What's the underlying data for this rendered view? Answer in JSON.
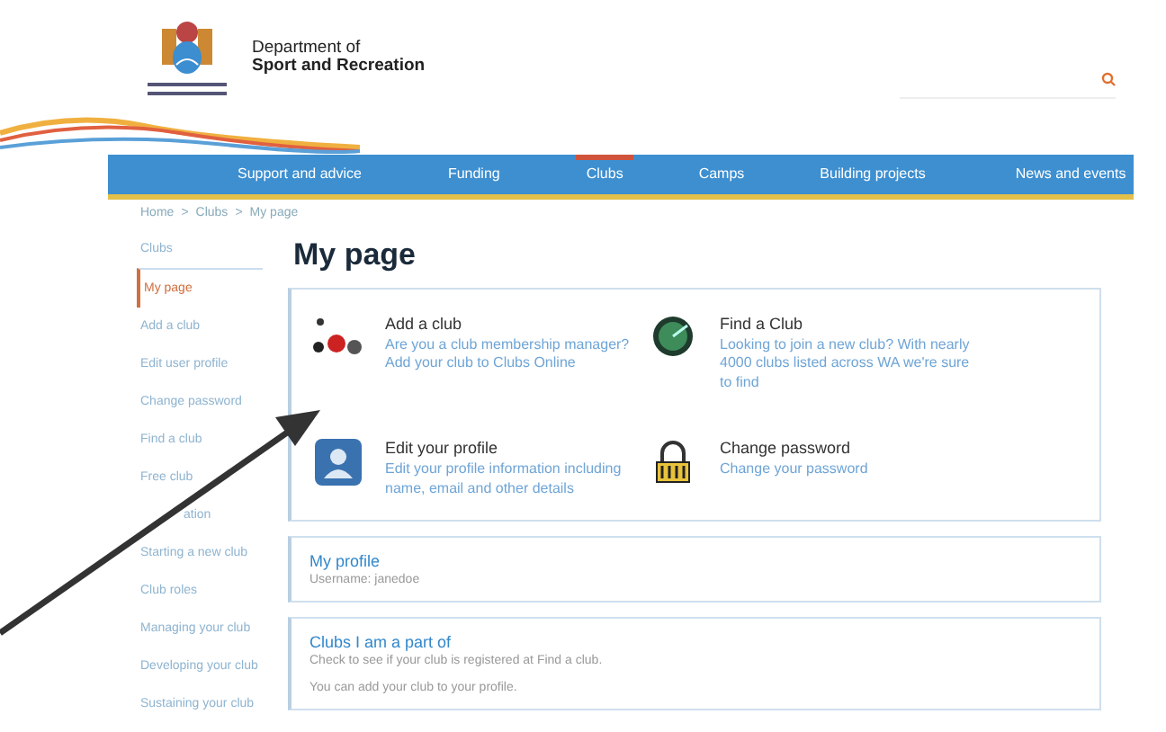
{
  "header": {
    "org_line_1": "Department of",
    "org_line_2": "Sport and Recreation"
  },
  "nav": [
    {
      "label": "Support and advice",
      "selected": false
    },
    {
      "label": "Funding",
      "selected": false
    },
    {
      "label": "Clubs",
      "selected": true
    },
    {
      "label": "Camps",
      "selected": false
    },
    {
      "label": "Building projects",
      "selected": false
    },
    {
      "label": "News and events",
      "selected": false
    }
  ],
  "breadcrumb": {
    "separator": ">",
    "items": [
      "Home",
      "Clubs",
      "My page"
    ]
  },
  "sidebar": {
    "heading": "Clubs",
    "items": [
      {
        "label": "My page",
        "selected": true
      },
      {
        "label": "Add a club",
        "selected": false
      },
      {
        "label": "Edit user profile",
        "selected": false
      },
      {
        "label": "Change password",
        "selected": false
      },
      {
        "label": "Find a club",
        "selected": false
      },
      {
        "label": "Free club",
        "selected": false
      },
      {
        "label": "ation",
        "selected": false
      },
      {
        "label": "Starting a new club",
        "selected": false
      },
      {
        "label": "Club roles",
        "selected": false
      },
      {
        "label": "Managing your club",
        "selected": false
      },
      {
        "label": "Developing your club",
        "selected": false
      },
      {
        "label": "Sustaining your club",
        "selected": false
      }
    ]
  },
  "page_title": "My page",
  "actions": [
    {
      "kind": "add",
      "title": "Add a club",
      "text": "Are you a club membership manager? Add your club to Clubs Online"
    },
    {
      "kind": "find",
      "title": "Find a Club",
      "text": "Looking to join a new club? With nearly 4000 clubs listed across WA we're sure to find"
    },
    {
      "kind": "profile",
      "title": "Edit your profile",
      "text": "Edit your profile information including name, email and other details"
    },
    {
      "kind": "password",
      "title": "Change password",
      "text": "Change your password"
    }
  ],
  "profile": {
    "title": "My profile",
    "text": "Username: janedoe"
  },
  "clubs": {
    "title": "Clubs I am a part of",
    "text": "Check to see if your club is registered at Find a club.",
    "note": "You can add your club to your profile."
  }
}
